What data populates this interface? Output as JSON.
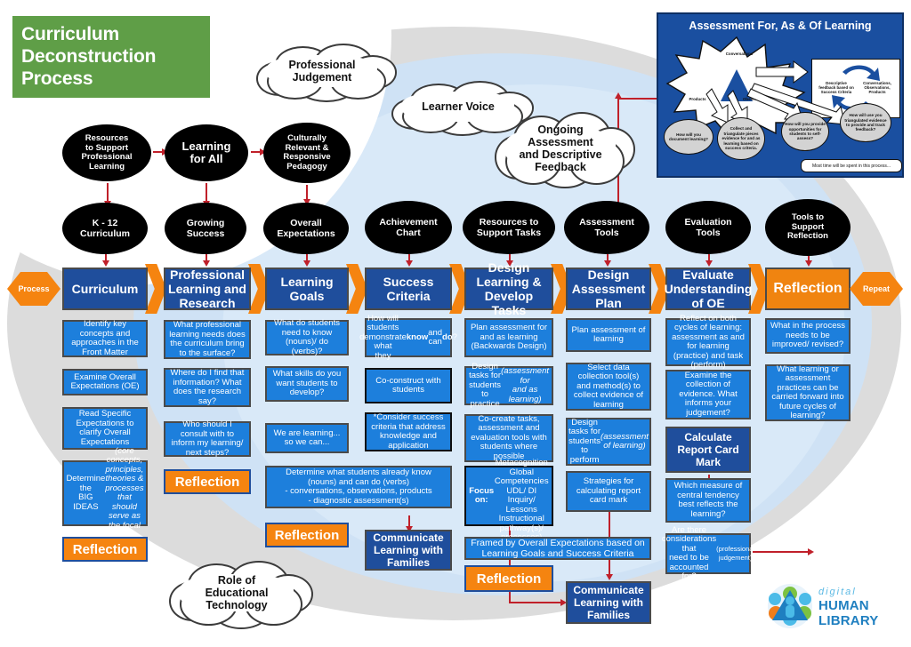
{
  "title": "Curriculum Deconstruction Process",
  "colors": {
    "title_green": "#5f9e47",
    "header_navy": "#1f4e9c",
    "box_blue": "#1d7fdc",
    "accent_orange": "#f58410",
    "arrow_red": "#c0202a",
    "bg_grey": "#dcdcdc",
    "bg_blue": "#cfe2f5",
    "inset_blue": "#1a4fa0"
  },
  "hexes": {
    "left": "Process",
    "right": "Repeat"
  },
  "clouds": [
    {
      "id": "professional-judgement",
      "text": "Professional\nJudgement"
    },
    {
      "id": "learner-voice",
      "text": "Learner Voice"
    },
    {
      "id": "ongoing-assessment",
      "text": "Ongoing\nAssessment\nand Descriptive\nFeedback"
    },
    {
      "id": "role-of-ed-tech",
      "text": "Role of\nEducational\nTechnology"
    }
  ],
  "top_ellipses": [
    {
      "id": "resources-to-support-professional-learning",
      "text": "Resources\nto Support\nProfessional\nLearning"
    },
    {
      "id": "learning-for-all",
      "text": "Learning\nfor All"
    },
    {
      "id": "culturally-relevant-responsive-pedagogy",
      "text": "Culturally\nRelevant &\nResponsive\nPedagogy"
    }
  ],
  "source_ellipses": [
    {
      "id": "k-12-curriculum",
      "text": "K - 12\nCurriculum"
    },
    {
      "id": "growing-success",
      "text": "Growing\nSuccess"
    },
    {
      "id": "overall-expectations",
      "text": "Overall\nExpectations"
    },
    {
      "id": "achievement-chart",
      "text": "Achievement\nChart"
    },
    {
      "id": "resources-to-support-tasks",
      "text": "Resources to\nSupport Tasks"
    },
    {
      "id": "assessment-tools",
      "text": "Assessment\nTools"
    },
    {
      "id": "evaluation-tools",
      "text": "Evaluation\nTools"
    },
    {
      "id": "tools-to-support-reflection",
      "text": "Tools to\nSupport\nReflection"
    }
  ],
  "columns": [
    {
      "id": "curriculum",
      "header": "Curriculum",
      "header_style": "navy",
      "boxes": [
        "Identify key concepts and approaches in the Front Matter",
        "Examine Overall Expectations (OE)",
        "Read Specific Expectations to clarify Overall Expectations",
        "Determine the BIG IDEAS (core concepts, principles, theories & processes that should serve as the focal point)",
        "Reflection"
      ]
    },
    {
      "id": "professional-learning-and-research",
      "header": "Professional Learning and Research",
      "header_style": "navy",
      "boxes": [
        "What professional learning needs does the curriculum bring to the surface?",
        "Where do I find that information? What does the research say?",
        "Who should I consult with to inform my learning/ next steps?",
        "Reflection"
      ]
    },
    {
      "id": "learning-goals",
      "header": "Learning Goals",
      "header_style": "navy",
      "boxes": [
        "What do students need to know (nouns)/ do (verbs)?",
        "What skills do you want students to develop?",
        "We are learning... so we can...",
        "Determine what students already know (nouns) and can do (verbs) - conversations, observations, products - diagnostic assessment(s)",
        "Reflection"
      ]
    },
    {
      "id": "success-criteria",
      "header": "Success Criteria",
      "header_style": "navy",
      "boxes": [
        "How will students demonstrate what they know and can do?",
        "Co-construct with students",
        "*Consider success criteria that address knowledge and application",
        "Communicate Learning with Families"
      ]
    },
    {
      "id": "design-learning-develop-tasks",
      "header": "Design Learning & Develop Tasks",
      "header_style": "navy",
      "boxes": [
        "Plan assessment for and as learning (Backwards Design)",
        "Design tasks for students to practice (assessment for and as learning)",
        "Co-create tasks, assessment and evaluation tools with students where possible",
        "Focus on: Metacognition Global Competencies UDL/ DI Inquiry/ Lessons Instructional pathway(s)/ processes)",
        "Reflection"
      ]
    },
    {
      "id": "design-assessment-plan",
      "header": "Design Assessment Plan",
      "header_style": "navy",
      "boxes": [
        "Plan assessment of learning",
        "Select data collection tool(s) and method(s) to collect evidence of learning",
        "Design tasks for students to perform (assessment of learning)",
        "Strategies for calculating report card mark",
        "Communicate Learning with Families"
      ]
    },
    {
      "id": "evaluate-understanding-of-oe",
      "header": "Evaluate Understanding of OE",
      "header_style": "navy",
      "boxes": [
        "Reflect on both cycles of learning: assessment as and for learning (practice) and task (perform)",
        "Examine the collection of evidence. What informs your judgement?",
        "Calculate Report Card Mark",
        "Which measure of central tendency best reflects the learning?",
        "Are there considerations that need to be accounted for? (professional judgement)"
      ]
    },
    {
      "id": "reflection",
      "header": "Reflection",
      "header_style": "orange",
      "boxes": [
        "What in the process needs to be improved/ revised?",
        "What learning or assessment practices can be carried forward into future cycles of learning?",
        "Communicate Learning with Families"
      ]
    }
  ],
  "framed_banner": "Framed by Overall Expectations based on Learning Goals and Success Criteria",
  "inset": {
    "title": "Assessment For, As & Of Learning",
    "star_labels": [
      "Conversations",
      "Products",
      "Observations"
    ],
    "box_labels": [
      "Descriptive feedback based on Success Criteria",
      "Conversations, Observations, Products"
    ],
    "clouds": [
      "How will you document learning?",
      "Collect and triangulate pieces evidence for and as learning based on success criteria.",
      "How will you provide opportunities for students to self-assess?",
      "How will use you triangulated evidence to provide and track feedback?"
    ],
    "footnote": "Most time will be spent in this process..."
  },
  "logo": {
    "line1": "digital",
    "line2": "HUMAN LIBRARY"
  }
}
